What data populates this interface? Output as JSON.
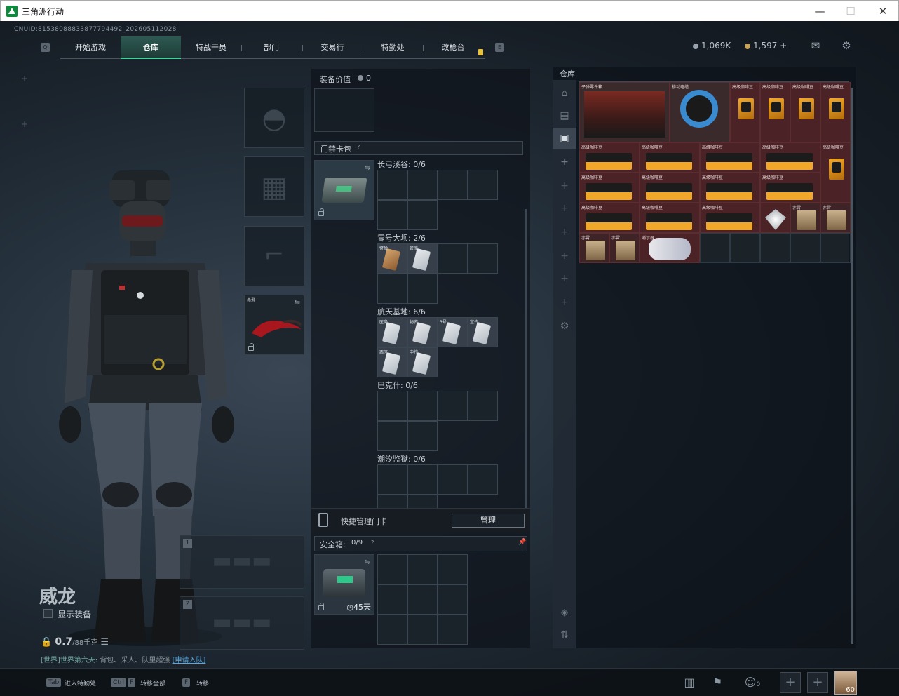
{
  "window": {
    "title": "三角洲行动",
    "min": "—",
    "max": "☐",
    "close": "✕"
  },
  "uid": "CNUID:8153808883387779449​2_202605112028",
  "nav": {
    "tabs": [
      "开始游戏",
      "仓库",
      "特战干员",
      "部门",
      "交易行",
      "特勤处",
      "改枪台"
    ],
    "key_left": "Q",
    "key_right": "E"
  },
  "currency": {
    "coins": "1,069K",
    "points": "1,597",
    "plus": "+"
  },
  "character": {
    "name": "威龙",
    "show_equipment": "显示装备",
    "weight": "0.7",
    "weight_max": "/88千克"
  },
  "system_msg": {
    "prefix": "[世界]",
    "user": "世界第六天:",
    "text": "背包、采人、队里超强",
    "invite": "[申请入队]"
  },
  "equip_slots": {
    "melee_label": "赤澄",
    "weapon_slot_1": "1",
    "weapon_slot_2": "2"
  },
  "mid": {
    "equip_value_label": "装备价值",
    "equip_value": "0",
    "keycard_bag": "门禁卡包",
    "help": "?",
    "maps": [
      {
        "name": "长弓溪谷: 0/6"
      },
      {
        "name": "零号大坝: 2/6",
        "cards": [
          "警检",
          "管库"
        ]
      },
      {
        "name": "航天基地: 6/6",
        "cards": [
          "医务",
          "物资",
          "3号",
          "宣传",
          "西区",
          "中控"
        ]
      },
      {
        "name": "巴克什: 0/6"
      },
      {
        "name": "潮汐监狱: 0/6"
      }
    ],
    "quick_manage": "快捷管理门卡",
    "manage_btn": "管理",
    "safebox": "安全箱:",
    "safebox_count": "0/9",
    "safebox_days": "45天",
    "pin": "📌"
  },
  "stash": {
    "title": "仓库",
    "items": [
      {
        "name": "子弹零件箱",
        "kind": "ammo"
      },
      {
        "name": "移动电缆",
        "kind": "cable"
      },
      {
        "name": "高级咖啡豆",
        "kind": "bag"
      },
      {
        "name": "高级咖啡豆",
        "kind": "bag"
      },
      {
        "name": "高级咖啡豆",
        "kind": "bag"
      },
      {
        "name": "高级咖啡豆",
        "kind": "bag"
      },
      {
        "name": "高级咖啡豆",
        "kind": "coffee"
      },
      {
        "name": "高级咖啡豆",
        "kind": "coffee"
      },
      {
        "name": "高级咖啡豆",
        "kind": "coffee"
      },
      {
        "name": "高级咖啡豆",
        "kind": "coffee"
      },
      {
        "name": "高级咖啡豆",
        "kind": "bag"
      },
      {
        "name": "高级咖啡豆",
        "kind": "coffee"
      },
      {
        "name": "高级咖啡豆",
        "kind": "coffee"
      },
      {
        "name": "高级咖啡豆",
        "kind": "coffee"
      },
      {
        "name": "高级咖啡豆",
        "kind": "coffee"
      },
      {
        "name": "高级咖啡豆",
        "kind": "coffee"
      },
      {
        "name": "高级咖啡豆",
        "kind": "coffee"
      },
      {
        "name": "高级咖啡豆",
        "kind": "coffee"
      },
      {
        "name": "",
        "kind": "diamond"
      },
      {
        "name": "赤霄",
        "kind": "print"
      },
      {
        "name": "赤霄",
        "kind": "print"
      },
      {
        "name": "赤霄",
        "kind": "print"
      },
      {
        "name": "赤霄",
        "kind": "print"
      },
      {
        "name": "哨示器",
        "kind": "device"
      }
    ]
  },
  "bottom": {
    "k1": "Tab",
    "l1": "进入特勤处",
    "k2": "Ctrl",
    "k2b": "F",
    "l2": "转移全部",
    "k3": "F",
    "l3": "转移",
    "friends": "0",
    "avatar_badge": "60"
  },
  "colors": {
    "accent": "#44d29a",
    "item_bg": "#4b2226",
    "panel": "#0f141a"
  }
}
